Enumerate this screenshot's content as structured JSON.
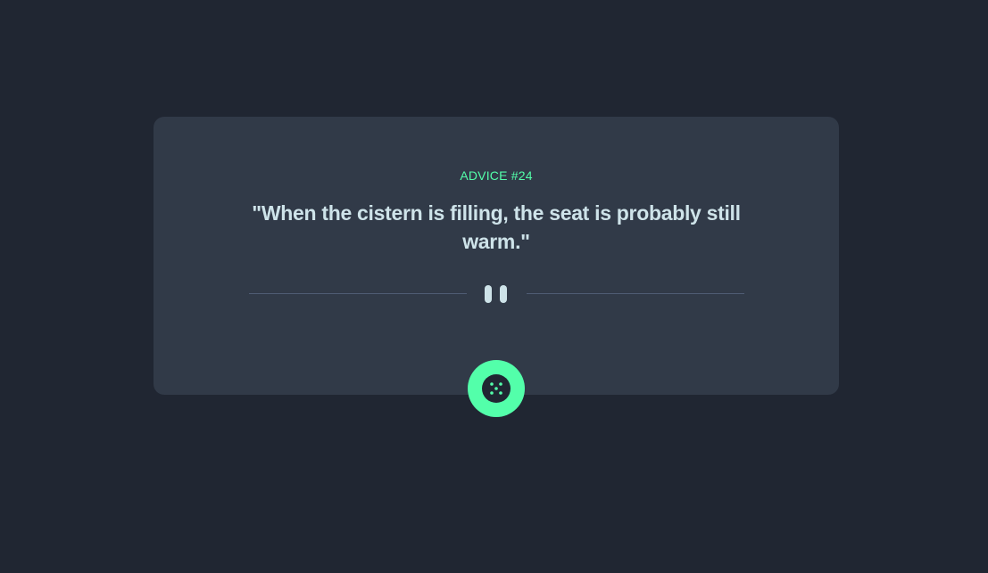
{
  "advice": {
    "label": "ADVICE #24",
    "quote": "\"When the cistern is filling, the seat is probably still warm.\""
  },
  "icons": {
    "divider": "pause-icon",
    "button": "dice-icon"
  },
  "colors": {
    "background": "#202632",
    "card": "#313a48",
    "accent": "#53ffaa",
    "text": "#cee3e9",
    "divider": "#4f5d74"
  }
}
